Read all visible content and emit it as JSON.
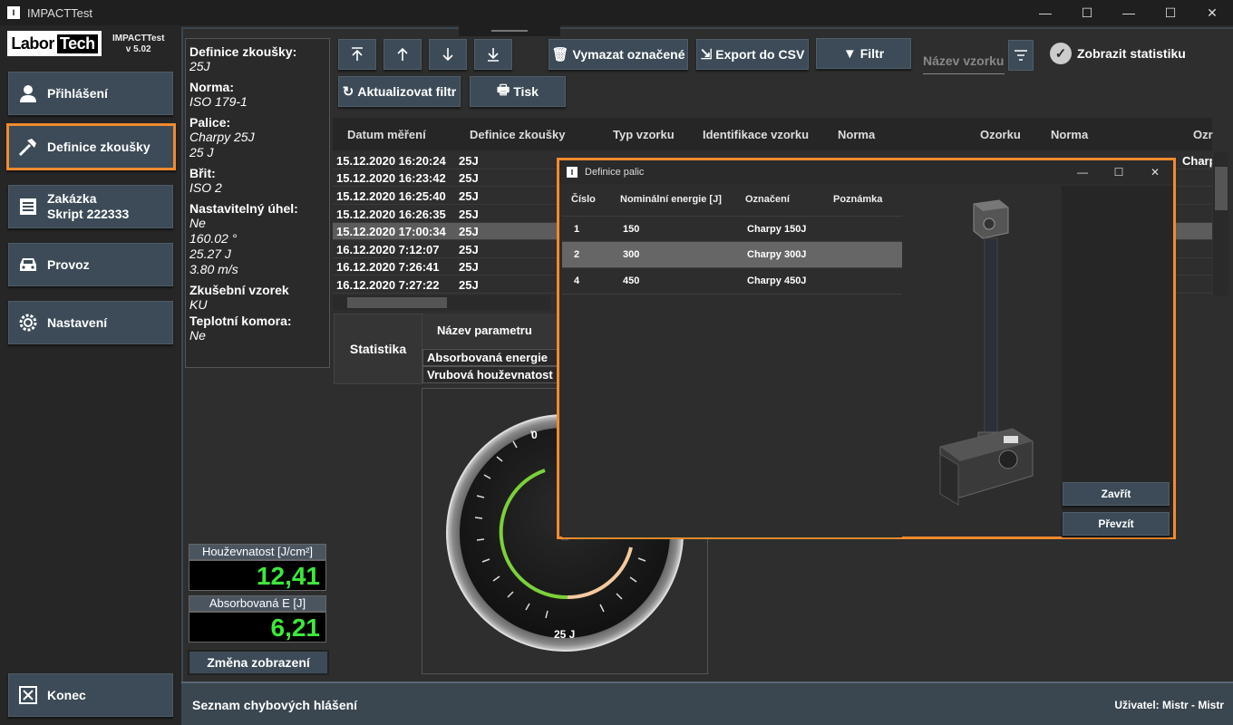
{
  "window": {
    "title": "IMPACTTest"
  },
  "sidebar": {
    "logo_left": "Labor",
    "logo_right": "Tech",
    "app_name": "IMPACTTest",
    "version": "v 5.02",
    "items": [
      {
        "label": "Přihlášení",
        "icon": "user-icon"
      },
      {
        "label": "Definice zkoušky",
        "icon": "hammer-icon",
        "active": true
      },
      {
        "label": "Zakázka",
        "label2": "Skript 222333",
        "icon": "list-icon"
      },
      {
        "label": "Provoz",
        "icon": "car-icon"
      },
      {
        "label": "Nastavení",
        "icon": "gear-icon"
      }
    ],
    "exit_label": "Konec"
  },
  "info": {
    "test_def_key": "Definice zkoušky:",
    "test_def_val": "25J",
    "norm_key": "Norma:",
    "norm_val": "ISO 179-1",
    "hammer_key": "Palice:",
    "hammer_val1": "Charpy 25J",
    "hammer_val2": "25 J",
    "edge_key": "Břit:",
    "edge_val": "ISO 2",
    "angle_key": "Nastavitelný úhel:",
    "angle_val1": "Ne",
    "angle_val2": "160.02 °",
    "angle_val3": "25.27 J",
    "angle_val4": "3.80 m/s",
    "specimen_key": "Zkušební vzorek",
    "specimen_val": "KU",
    "chamber_key": "Teplotní komora:",
    "chamber_val": "Ne"
  },
  "readouts": {
    "toughness_label": "Houževnatost [J/cm²]",
    "toughness_value": "12,41",
    "energy_label": "Absorbovaná E [J]",
    "energy_value": "6,21",
    "change_view": "Změna zobrazení"
  },
  "toolbar": {
    "delete_selected": "Vymazat označené",
    "export_csv": "Export do CSV",
    "filter": "Filtr",
    "sample_name_placeholder": "Název vzorku",
    "show_stats": "Zobrazit statistiku",
    "refresh_filter": "Aktualizovat filtr",
    "print": "Tisk"
  },
  "table": {
    "headers": [
      "Datum měření",
      "Definice zkoušky",
      "Typ vzorku",
      "Identifikace vzorku",
      "Norma",
      "Ozorku",
      "Norma",
      "Ozr"
    ],
    "rows": [
      {
        "date": "15.12.2020 16:20:24",
        "def": "25J"
      },
      {
        "date": "15.12.2020 16:23:42",
        "def": "25J"
      },
      {
        "date": "15.12.2020 16:25:40",
        "def": "25J"
      },
      {
        "date": "15.12.2020 16:26:35",
        "def": "25J"
      },
      {
        "date": "15.12.2020 17:00:34",
        "def": "25J",
        "selected": true
      },
      {
        "date": "16.12.2020 7:12:07",
        "def": "25J"
      },
      {
        "date": "16.12.2020 7:26:41",
        "def": "25J"
      },
      {
        "date": "16.12.2020 7:27:22",
        "def": "25J"
      }
    ],
    "partial_cell": "Charp"
  },
  "stats": {
    "title": "Statistika",
    "param_header": "Název parametru",
    "rows": [
      "Absorbovaná energie",
      "Vrubová houževnatost"
    ]
  },
  "gauge": {
    "zero_label": "0",
    "value_label": "25 J"
  },
  "status": {
    "message": "Seznam chybových hlášení",
    "user": "Uživatel: Mistr - Mistr"
  },
  "dialog": {
    "title": "Definice palic",
    "headers": [
      "Číslo",
      "Nominální energie [J]",
      "Označení",
      "Poznámka"
    ],
    "rows": [
      {
        "num": "1",
        "energy": "150",
        "name": "Charpy 150J",
        "note": ""
      },
      {
        "num": "2",
        "energy": "300",
        "name": "Charpy 300J",
        "note": "",
        "selected": true
      },
      {
        "num": "4",
        "energy": "450",
        "name": "Charpy 450J",
        "note": ""
      }
    ],
    "close_label": "Zavřít",
    "accept_label": "Převzít"
  },
  "colors": {
    "accent": "#f28a2e",
    "button": "#3c4b57",
    "readout": "#3ee83a"
  }
}
